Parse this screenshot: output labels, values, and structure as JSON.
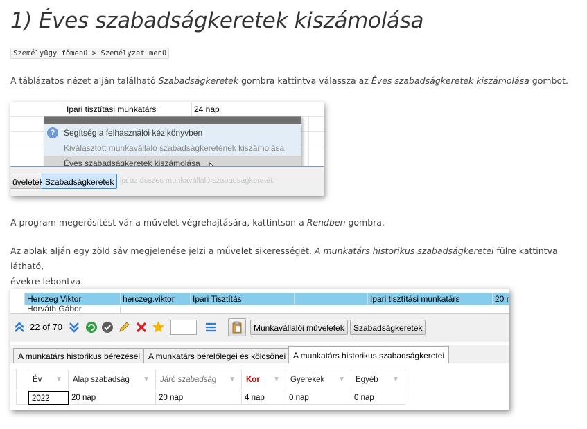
{
  "title": "1) Éves szabadságkeretek kiszámolása",
  "breadcrumb": "Személyügy főmenü > Személyzet menü",
  "para1": {
    "t1": "A táblázatos nézet alján található ",
    "i1": "Szabadságkeretek",
    "t2": " gombra kattintva válassza az ",
    "i2": "Éves szabadságkeretek kiszámolása",
    "t3": " gombot."
  },
  "para2": {
    "t1": "A program megerősítést vár a művelet végrehajtására, kattintson a ",
    "i1": "Rendben",
    "t2": " gombra."
  },
  "para3": {
    "t1": "Az ablak alján egy zöld sáv megjelenése jelzi a művelet sikerességét. ",
    "i1": "A munkatárs historikus szabadságkeretei",
    "t2": " fülre kattintva látható,",
    "line2": "évekre lebontva."
  },
  "shot1": {
    "row_role": "Ipari tisztítási munkatárs",
    "row_days": "24 nap",
    "menu": {
      "help": "Segítség a felhasználói kézikönyvben",
      "selected": "Kiválasztott munkavállaló szabadságkeretének kiszámolása",
      "annual": "Éves szabadságkeretek kiszámolása"
    },
    "btn_left": "űveletek",
    "btn_szabadsag": "Szabadságkeretek",
    "ghost_text": "lja az összes munkavállaló szabadságkeretét."
  },
  "shot2": {
    "row1": [
      "Herczeg Viktor",
      "herczeg.viktor",
      "Ipari Tisztítás",
      "",
      "Ipari tisztítási munkatárs",
      "20 n"
    ],
    "row2_partial": "Horváth Gábor",
    "nav_count": "22 of 70",
    "btn_munkavallaloi": "Munkavállalói műveletek",
    "btn_szabadsag": "Szabadságkeretek",
    "tabs": [
      "A munkatárs historikus bérezései",
      "A munkatárs bérelőlegei és kölcsönei",
      "A munkatárs historikus szabadságkeretei"
    ],
    "columns": [
      "Év",
      "Alap szabadság",
      "Járó szabadság",
      "Kor",
      "Gyerekek",
      "Egyéb"
    ],
    "row": [
      "2022",
      "20 nap",
      "20 nap",
      "4 nap",
      "0 nap",
      "0 nap"
    ],
    "colors": {
      "selected_row": "#87cdeb",
      "nav_blue": "#2a7ad6",
      "accent_red": "#c00000"
    }
  }
}
